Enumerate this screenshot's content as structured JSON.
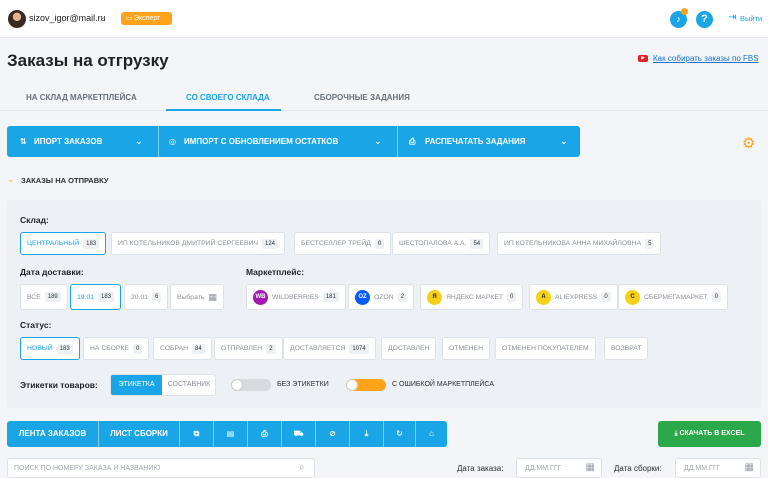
{
  "header": {
    "email": "sizov_igor@mail.ru",
    "plan": "Эксперт",
    "logout": "Выйти"
  },
  "page": {
    "title": "Заказы на отгрузку",
    "howto": "Как собирать заказы по FBS"
  },
  "tabs": [
    "НА СКЛАД МАРКЕТПЛЕЙСА",
    "СО СВОЕГО СКЛАДА",
    "СБОРОЧНЫЕ ЗАДАНИЯ"
  ],
  "actions": {
    "import": "ИПОРТ ЗАКАЗОВ",
    "import_update": "ИМПОРТ С ОБНОВЛЕНИЕМ ОСТАТКОВ",
    "print": "РАСПЕЧАТАТЬ ЗАДАНИЯ"
  },
  "section": {
    "title": "ЗАКАЗЫ НА ОТПРАВКУ"
  },
  "filters": {
    "warehouse_label": "Склад:",
    "warehouses": [
      {
        "label": "ЦЕНТРАЛЬНЫЙ",
        "count": "183"
      },
      {
        "label": "ИП КОТЕЛЬНИКОВ ДМИТРИЙ СЕРГЕЕВИЧ",
        "count": "124"
      },
      {
        "label": "БЕСТСЕЛЛЕР ТРЕЙД",
        "count": "0"
      },
      {
        "label": "ШЕСТОПАЛОВА А.А.",
        "count": "54"
      },
      {
        "label": "ИП КОТЕЛЬНИКОВА АННА МИХАЙЛОВНА",
        "count": "5"
      }
    ],
    "delivery_label": "Дата доставки:",
    "delivery": [
      {
        "label": "ВСЕ",
        "count": "189"
      },
      {
        "label": "19.01",
        "count": "183"
      },
      {
        "label": "20.01",
        "count": "6"
      }
    ],
    "delivery_pick": "Выбрать",
    "mp_label": "Маркетплейс:",
    "marketplaces": [
      {
        "label": "WILDBERRIES",
        "count": "181",
        "icon": "WB",
        "color": "#a11ab0"
      },
      {
        "label": "OZON",
        "count": "2",
        "icon": "OZ",
        "color": "#005bff"
      },
      {
        "label": "ЯНДЕКС МАРКЕТ",
        "count": "0",
        "icon": "Я",
        "color": "#f7d117"
      },
      {
        "label": "ALIEXPRESS",
        "count": "0",
        "icon": "A",
        "color": "#f7d117"
      },
      {
        "label": "СБЕРМЕГАМАРКЕТ",
        "count": "0",
        "icon": "С",
        "color": "#f7d117"
      }
    ],
    "status_label": "Статус:",
    "statuses": [
      {
        "label": "НОВЫЙ",
        "count": "183"
      },
      {
        "label": "НА СБОРКЕ",
        "count": "0"
      },
      {
        "label": "СОБРАН",
        "count": "84"
      },
      {
        "label": "ОТПРАВЛЕН",
        "count": "2"
      },
      {
        "label": "ДОСТАВЛЯЕТСЯ",
        "count": "1074"
      },
      {
        "label": "ДОСТАВЛЕН",
        "count": ""
      },
      {
        "label": "ОТМЕНЕН",
        "count": ""
      },
      {
        "label": "ОТМЕНЕН ПОКУПАТЕЛЕМ",
        "count": ""
      },
      {
        "label": "ВОЗВРАТ",
        "count": ""
      }
    ],
    "labels_label": "Этикетки товаров:",
    "seg_a": "ЭТИКЕТКА",
    "seg_b": "СОСТАВНИК",
    "toggle_no": "БЕЗ ЭТИКЕТКИ",
    "toggle_err": "С ОШИБКОЙ МАРКЕТПЛЕЙСА"
  },
  "toolbar": {
    "feed": "ЛЕНТА ЗАКАЗОВ",
    "sheet": "ЛИСТ СБОРКИ",
    "excel": "СКАЧАТЬ В EXCEL"
  },
  "search": {
    "placeholder": "ПОИСК ПО НОМЕРУ ЗАКАЗА И НАЗВАНИЮ"
  },
  "dates": {
    "order_label": "Дата заказа:",
    "build_label": "Дата сборки:",
    "placeholder": "ДД.ММ.ГГГ"
  },
  "colors": {
    "accent": "#1aa6e6",
    "orange": "#ffa31a",
    "green": "#2aa84a"
  }
}
